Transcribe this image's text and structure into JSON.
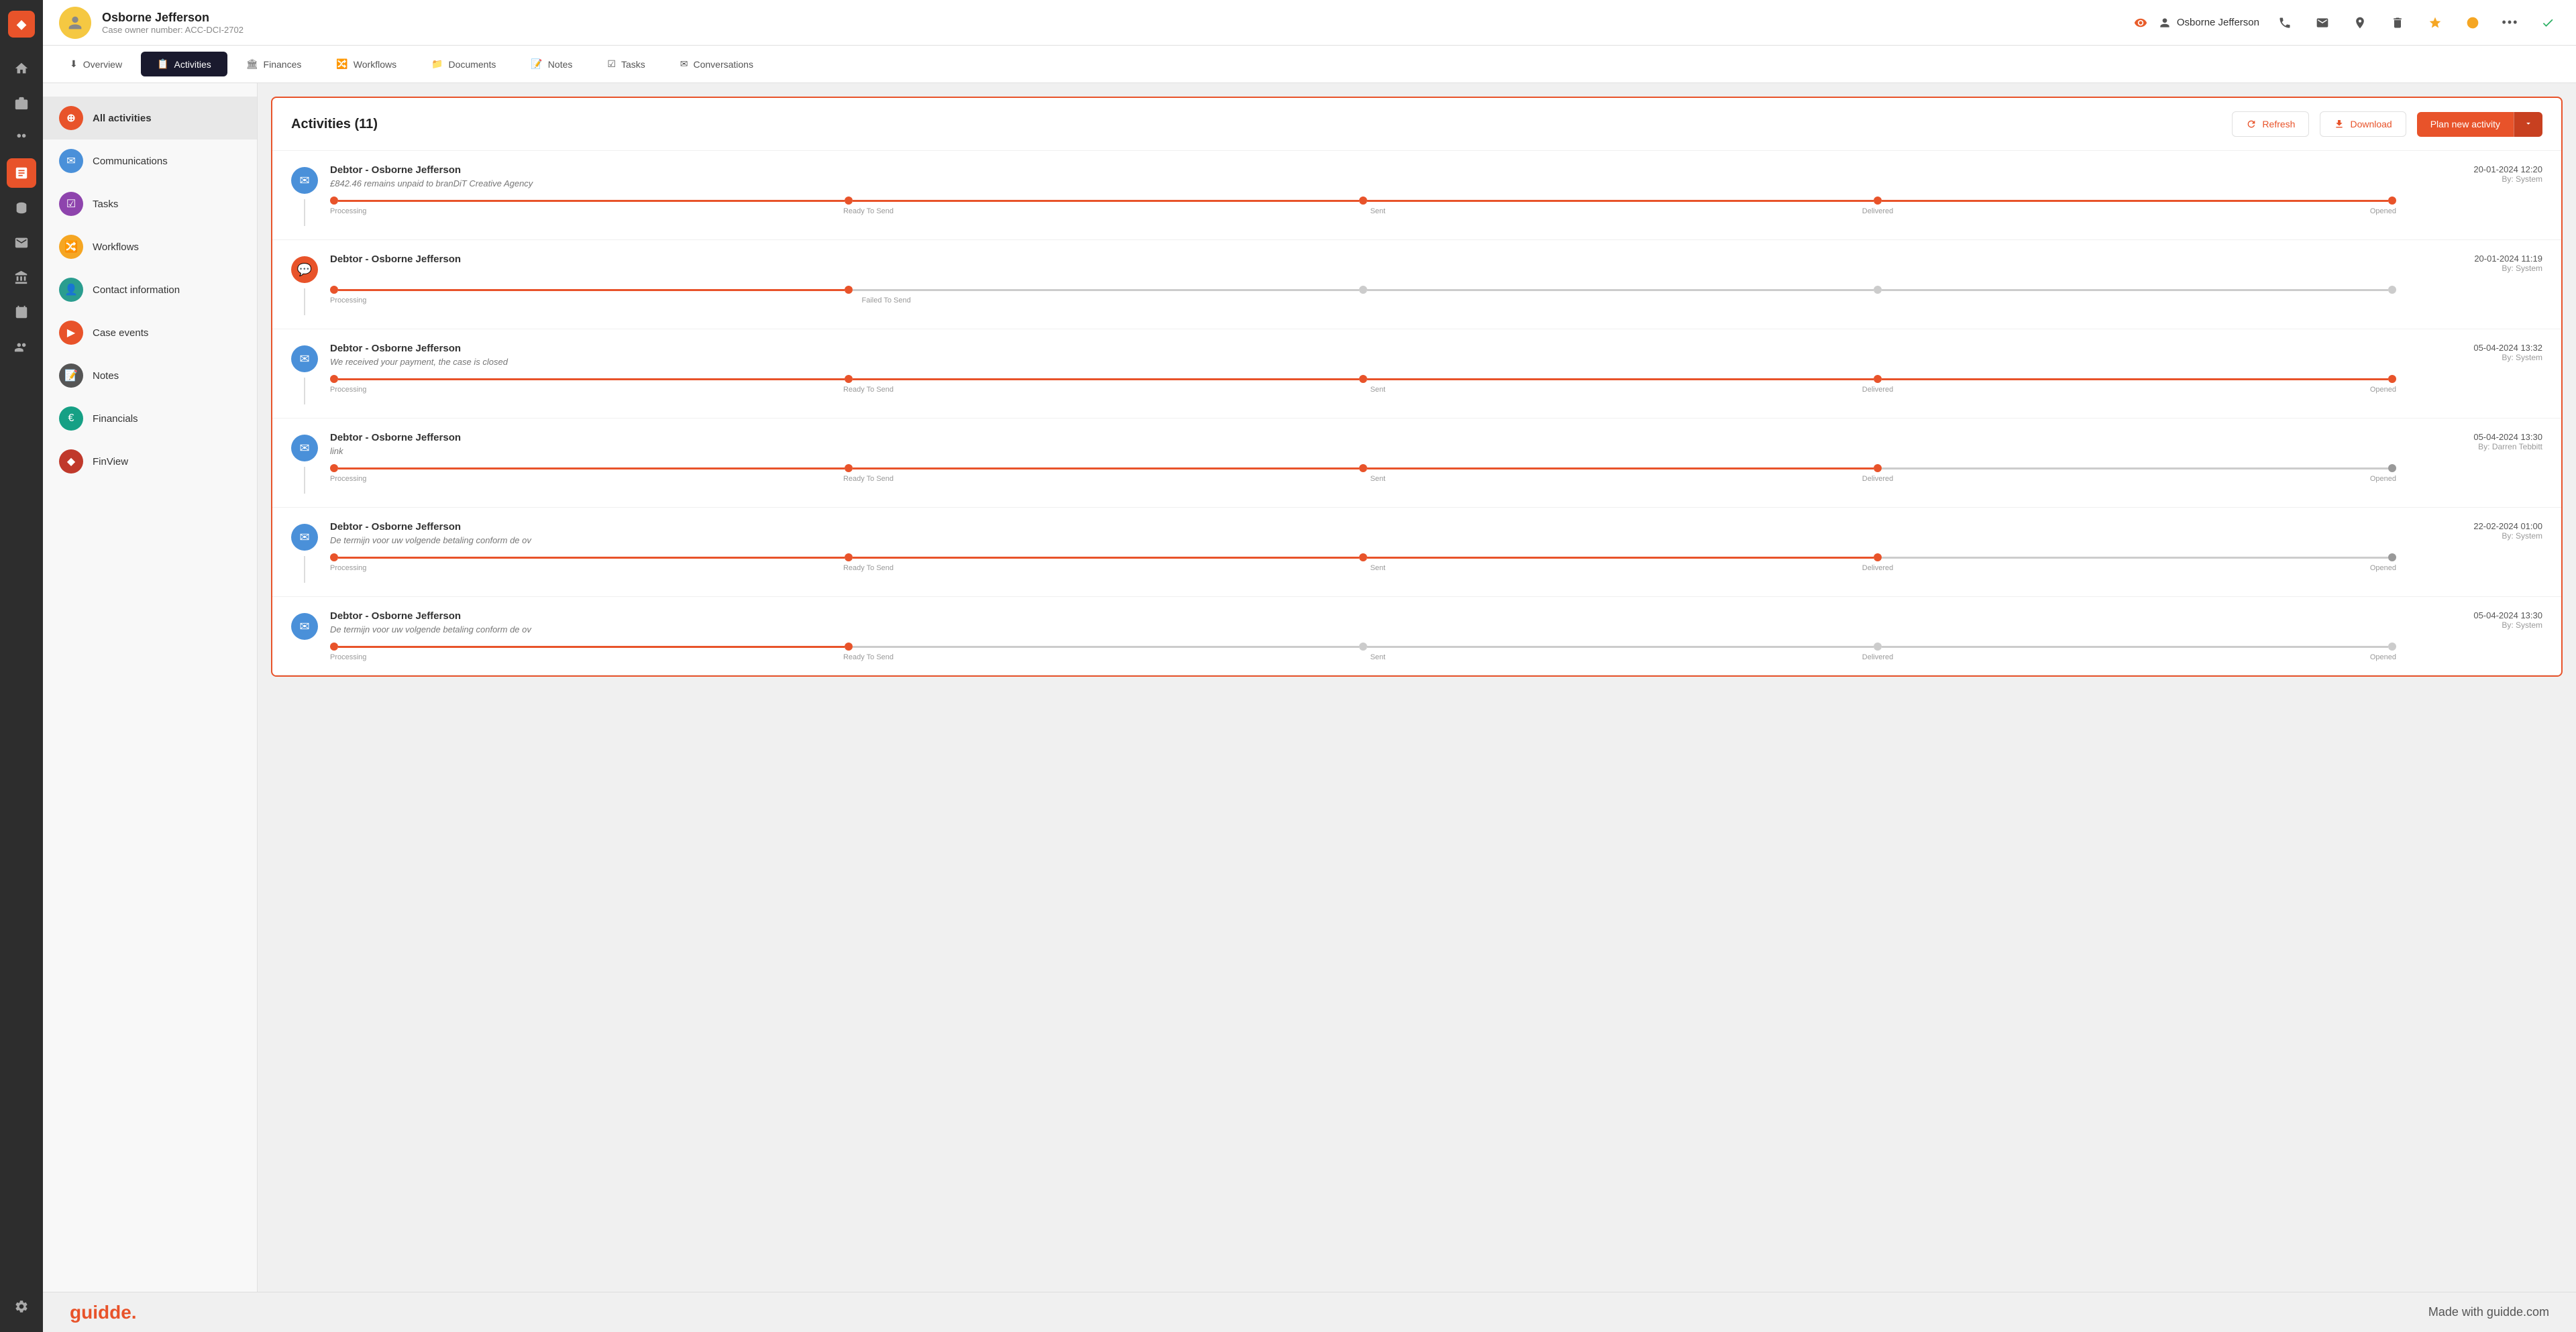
{
  "app": {
    "logo": "◆"
  },
  "header": {
    "case_avatar": "♂",
    "case_name": "Osborne Jefferson",
    "case_number": "Case owner number: ACC-DCI-2702",
    "eye_icon": "👁",
    "user_name": "Osborne Jefferson",
    "icons": [
      "📞",
      "✉",
      "📍",
      "🗑",
      "⭐",
      "💰",
      "•••",
      "✓"
    ]
  },
  "tabs": [
    {
      "id": "overview",
      "label": "Overview",
      "icon": "⬇",
      "active": false
    },
    {
      "id": "activities",
      "label": "Activities",
      "icon": "📋",
      "active": true
    },
    {
      "id": "finances",
      "label": "Finances",
      "icon": "🏛",
      "active": false
    },
    {
      "id": "workflows",
      "label": "Workflows",
      "icon": "🔀",
      "active": false
    },
    {
      "id": "documents",
      "label": "Documents",
      "icon": "📁",
      "active": false
    },
    {
      "id": "notes",
      "label": "Notes",
      "icon": "📝",
      "active": false
    },
    {
      "id": "tasks",
      "label": "Tasks",
      "icon": "☑",
      "active": false
    },
    {
      "id": "conversations",
      "label": "Conversations",
      "icon": "✉",
      "active": false
    }
  ],
  "sidebar_nav": [
    {
      "id": "all-activities",
      "label": "All activities",
      "icon": "⊕",
      "color": "icon-red"
    },
    {
      "id": "communications",
      "label": "Communications",
      "icon": "✉",
      "color": "icon-blue"
    },
    {
      "id": "tasks",
      "label": "Tasks",
      "icon": "☑",
      "color": "icon-purple"
    },
    {
      "id": "workflows",
      "label": "Workflows",
      "icon": "🔀",
      "color": "icon-yellow"
    },
    {
      "id": "contact-info",
      "label": "Contact information",
      "icon": "👤",
      "color": "icon-teal"
    },
    {
      "id": "case-events",
      "label": "Case events",
      "icon": "▶",
      "color": "icon-red"
    },
    {
      "id": "notes",
      "label": "Notes",
      "icon": "📝",
      "color": "icon-dark"
    },
    {
      "id": "financials",
      "label": "Financials",
      "icon": "€",
      "color": "icon-euro"
    },
    {
      "id": "finview",
      "label": "FinView",
      "icon": "◆",
      "color": "icon-fin"
    }
  ],
  "activities": {
    "title": "Activities",
    "count": 11,
    "refresh_label": "Refresh",
    "download_label": "Download",
    "plan_new_label": "Plan new activity",
    "items": [
      {
        "id": 1,
        "debtor": "Debtor - Osborne Jefferson",
        "description": "£842.46 remains unpaid to branDiT Creative Agency",
        "date": "20-01-2024 12:20",
        "by": "By: System",
        "icon_color": "blue",
        "icon": "✉",
        "timeline": [
          true,
          true,
          true,
          true,
          true
        ],
        "timeline_labels": [
          "Processing",
          "Ready To Send",
          "Sent",
          "Delivered",
          "Opened"
        ]
      },
      {
        "id": 2,
        "debtor": "Debtor - Osborne Jefferson",
        "description": "",
        "date": "20-01-2024 11:19",
        "by": "By: System",
        "icon_color": "orange",
        "icon": "💬",
        "timeline": [
          true,
          true,
          false,
          false,
          false
        ],
        "timeline_labels": [
          "Processing",
          "Failed To Send",
          "",
          "",
          ""
        ]
      },
      {
        "id": 3,
        "debtor": "Debtor - Osborne Jefferson",
        "description": "We received your payment, the case is closed",
        "date": "05-04-2024 13:32",
        "by": "By: System",
        "icon_color": "blue",
        "icon": "✉",
        "timeline": [
          true,
          true,
          true,
          true,
          true
        ],
        "timeline_labels": [
          "Processing",
          "Ready To Send",
          "Sent",
          "Delivered",
          "Opened"
        ]
      },
      {
        "id": 4,
        "debtor": "Debtor - Osborne Jefferson",
        "description": "link",
        "date": "05-04-2024 13:30",
        "by": "By: Darren Tebbitt",
        "icon_color": "blue",
        "icon": "✉",
        "timeline": [
          true,
          true,
          true,
          true,
          false
        ],
        "timeline_labels": [
          "Processing",
          "Ready To Send",
          "Sent",
          "Delivered",
          "Opened"
        ]
      },
      {
        "id": 5,
        "debtor": "Debtor - Osborne Jefferson",
        "description": "De termijn voor uw volgende betaling conform de ov",
        "date": "22-02-2024 01:00",
        "by": "By: System",
        "icon_color": "blue",
        "icon": "✉",
        "timeline": [
          true,
          true,
          true,
          true,
          false
        ],
        "timeline_labels": [
          "Processing",
          "Ready To Send",
          "Sent",
          "Delivered",
          "Opened"
        ]
      },
      {
        "id": 6,
        "debtor": "Debtor - Osborne Jefferson",
        "description": "De termijn voor uw volgende betaling conform de ov",
        "date": "05-04-2024 13:30",
        "by": "By: System",
        "icon_color": "blue",
        "icon": "✉",
        "timeline": [
          true,
          true,
          false,
          false,
          false
        ],
        "timeline_labels": [
          "Processing",
          "Ready To Send",
          "Sent",
          "Delivered",
          "Opened"
        ]
      }
    ]
  },
  "left_nav_icons": [
    "🏠",
    "📋",
    "👥",
    "📄",
    "✉",
    "🏛",
    "🔀",
    "👥",
    "⚙"
  ],
  "footer": {
    "logo": "guidde.",
    "tagline": "Made with guidde.com"
  }
}
